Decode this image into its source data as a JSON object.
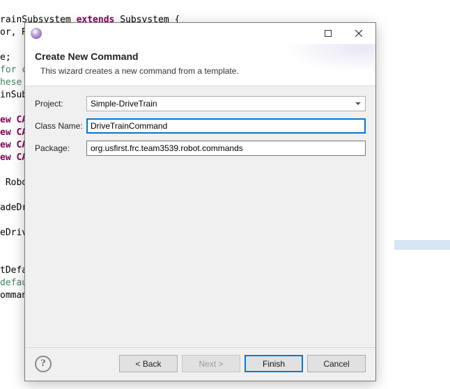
{
  "code": {
    "l1a": "rainSubsystem ",
    "l1b": "extends",
    "l1c": " Subsystem {",
    "l2": "or, RFMotor,RBMotor, LBMotor;",
    "l3": "",
    "l4": "e;",
    "l5": "for c",
    "l6": "hese",
    "l7": "inSub",
    "l8": "",
    "l9": "ew CA",
    "l10": "ew CA",
    "l11": "ew CA",
    "l12": "ew CA",
    "l13": "",
    "l14": " Robo",
    "l15": "",
    "l16": "adeDr",
    "l17": "",
    "l18": "eDriv",
    "l19": "",
    "l20": "",
    "l21": "tDefa",
    "l22": "defau",
    "l23": "omman"
  },
  "dialog": {
    "title": "Create New Command",
    "subtitle": "This wizard creates a new command from a template.",
    "labels": {
      "project": "Project:",
      "className": "Class Name:",
      "package": "Package:"
    },
    "values": {
      "project": "Simple-DriveTrain",
      "className": "DriveTrainCommand",
      "package": "org.usfirst.frc.team3539.robot.commands"
    },
    "buttons": {
      "back": "< Back",
      "next": "Next >",
      "finish": "Finish",
      "cancel": "Cancel"
    },
    "help": "?"
  }
}
